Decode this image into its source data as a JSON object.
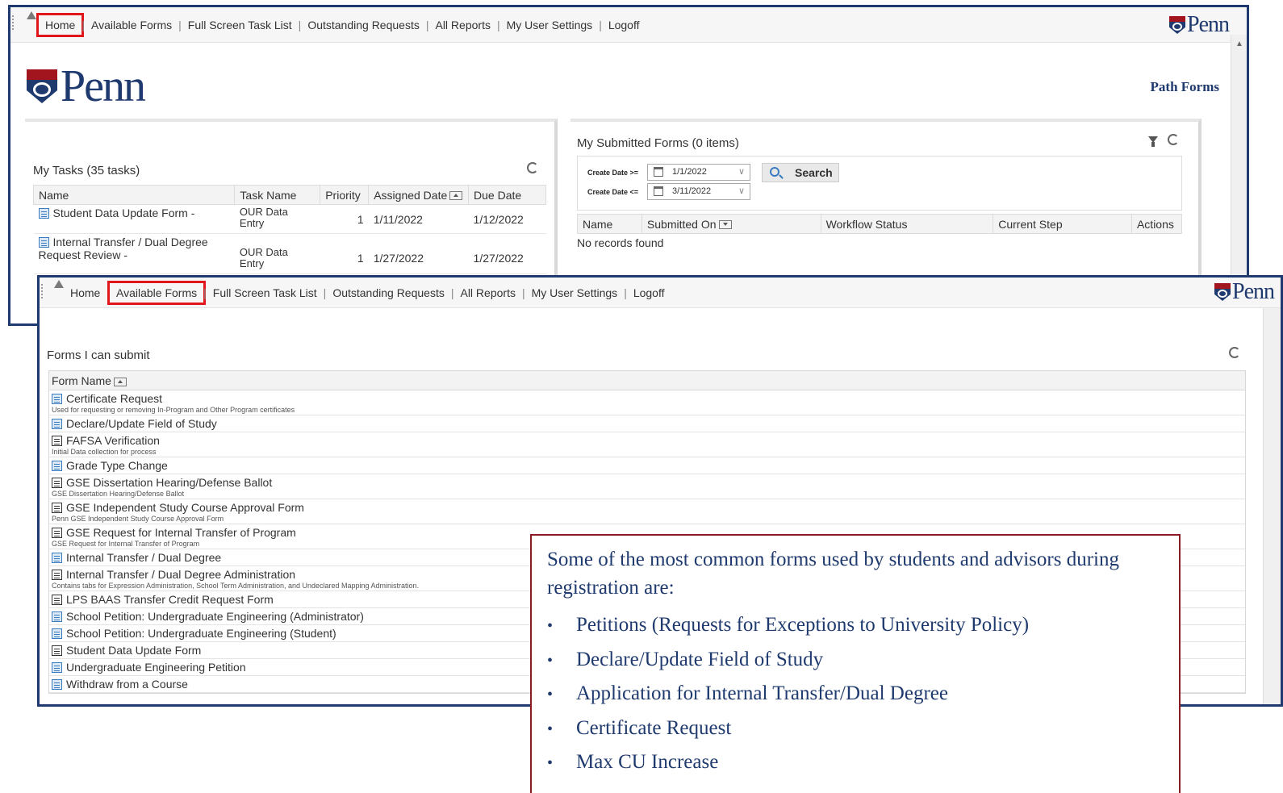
{
  "nav": {
    "items": [
      "Home",
      "Available Forms",
      "Full Screen Task List",
      "Outstanding Requests",
      "All Reports",
      "My User Settings",
      "Logoff"
    ],
    "separator": "|"
  },
  "brand": {
    "logo_text": "Penn",
    "app_name": "Path Forms"
  },
  "tasks": {
    "title": "My Tasks (35 tasks)",
    "columns": [
      "Name",
      "Task Name",
      "Priority",
      "Assigned Date",
      "Due Date"
    ],
    "rows": [
      {
        "name": "Student Data Update Form -",
        "task": "OUR Data Entry",
        "priority": "1",
        "assigned": "1/11/2022",
        "due": "1/12/2022"
      },
      {
        "name": "Internal Transfer / Dual Degree Request Review -",
        "task": "OUR Data Entry",
        "priority": "1",
        "assigned": "1/27/2022",
        "due": "1/27/2022"
      }
    ]
  },
  "submitted": {
    "title": "My Submitted Forms (0 items)",
    "filter": {
      "from_label": "Create Date >=",
      "from_value": "1/1/2022",
      "to_label": "Create Date <=",
      "to_value": "3/11/2022",
      "search_label": "Search"
    },
    "columns": [
      "Name",
      "Submitted On",
      "Workflow Status",
      "Current Step",
      "Actions"
    ],
    "empty_text": "No records found"
  },
  "forms": {
    "title": "Forms I can submit",
    "column": "Form Name",
    "rows": [
      {
        "name": "Certificate Request",
        "desc": "Used for requesting or removing In-Program and Other Program certificates",
        "icon": "form-icon"
      },
      {
        "name": "Declare/Update Field of Study",
        "desc": "",
        "icon": "form-icon"
      },
      {
        "name": "FAFSA Verification",
        "desc": "Initial Data collection for process",
        "icon": "form-dark-icon"
      },
      {
        "name": "Grade Type Change",
        "desc": "",
        "icon": "form-icon"
      },
      {
        "name": "GSE Dissertation Hearing/Defense Ballot",
        "desc": "GSE Dissertation Hearing/Defense Ballot",
        "icon": "form-dark-icon"
      },
      {
        "name": "GSE Independent Study Course Approval Form",
        "desc": "Penn GSE Independent Study Course Approval Form",
        "icon": "form-dark-icon"
      },
      {
        "name": "GSE Request for Internal Transfer of Program",
        "desc": "GSE Request for Internal Transfer of Program",
        "icon": "form-dark-icon"
      },
      {
        "name": "Internal Transfer / Dual Degree",
        "desc": "",
        "icon": "form-icon"
      },
      {
        "name": "Internal Transfer / Dual Degree Administration",
        "desc": "Contains tabs for Expression Administration, School Term Administration, and Undeclared Mapping Administration.",
        "icon": "form-dark-icon"
      },
      {
        "name": "LPS BAAS Transfer Credit Request Form",
        "desc": "",
        "icon": "form-dark-icon"
      },
      {
        "name": "School Petition: Undergraduate Engineering (Administrator)",
        "desc": "",
        "icon": "form-icon"
      },
      {
        "name": "School Petition: Undergraduate Engineering (Student)",
        "desc": "",
        "icon": "form-icon"
      },
      {
        "name": "Student Data Update Form",
        "desc": "",
        "icon": "form-dark-icon"
      },
      {
        "name": "Undergraduate Engineering Petition",
        "desc": "",
        "icon": "form-icon"
      },
      {
        "name": "Withdraw from a Course",
        "desc": "",
        "icon": "form-icon"
      }
    ]
  },
  "callout": {
    "intro": "Some of the most common forms used by students and advisors during registration are:",
    "bullet": "•",
    "items": [
      "Petitions (Requests for Exceptions to University Policy)",
      "Declare/Update Field of Study",
      "Application for Internal Transfer/Dual Degree",
      "Certificate Request",
      "Max CU Increase"
    ]
  },
  "colors": {
    "brand_navy": "#1f3a6e",
    "brand_red": "#a3151e",
    "highlight_red": "#e0161b",
    "callout_border": "#8b1a24"
  }
}
